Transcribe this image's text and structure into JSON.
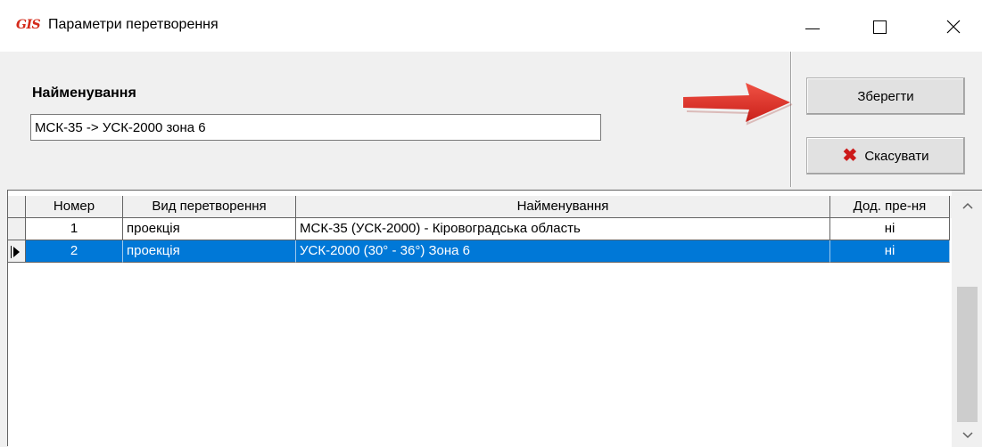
{
  "window": {
    "app_logo": "GIS",
    "title": "Параметри перетворення",
    "controls": {
      "minimize": "minimize-icon",
      "maximize": "maximize-icon",
      "close": "close-icon"
    }
  },
  "form": {
    "name_label": "Найменування",
    "name_value": "МСК-35 -> УСК-2000 зона 6"
  },
  "buttons": {
    "save": "Зберегти",
    "cancel": "Скасувати",
    "cancel_icon": "x-icon"
  },
  "annotation": {
    "arrow_icon": "red-arrow-icon",
    "arrow_color": "#e0241b"
  },
  "grid": {
    "headers": [
      "Номер",
      "Вид перетворення",
      "Найменування",
      "Дод. пре-ня"
    ],
    "rows": [
      {
        "number": "1",
        "type": "проекція",
        "name": "МСК-35 (УСК-2000) - Кіровоградська область",
        "extra": "ні"
      },
      {
        "number": "2",
        "type": "проекція",
        "name": "УСК-2000 (30° - 36°) Зона 6",
        "extra": "ні"
      }
    ],
    "selected_row": 2,
    "selection_color": "#0078d7"
  }
}
